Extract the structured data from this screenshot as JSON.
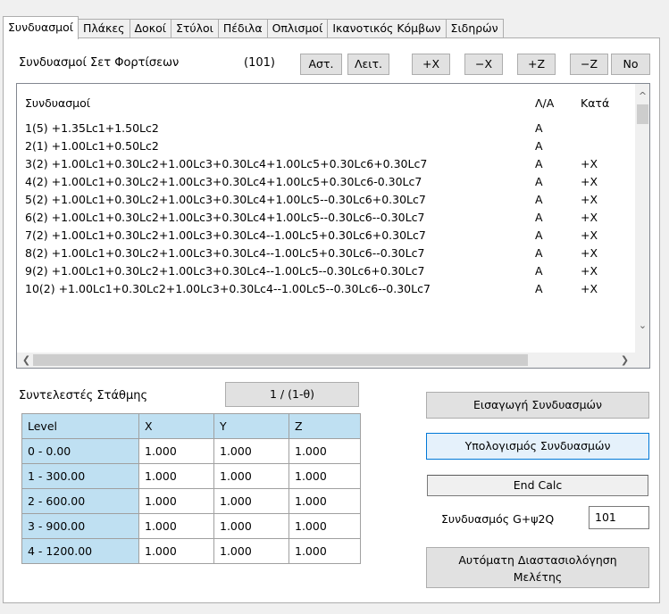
{
  "tabs": [
    "Συνδυασμοί",
    "Πλάκες",
    "Δοκοί",
    "Στύλοι",
    "Πέδιλα",
    "Οπλισμοί",
    "Ικανοτικός Κόμβων",
    "Σιδηρών"
  ],
  "active_tab": 0,
  "sets_label": "Συνδυασμοί Σετ Φορτίσεων",
  "sets_count": "(101)",
  "buttons_top": {
    "ast": "Αστ.",
    "leit": "Λειτ.",
    "px": "+X",
    "mx": "−X",
    "pz": "+Z",
    "mz": "−Z",
    "no": "No"
  },
  "list": {
    "headers": [
      "Συνδυασμοί",
      "Λ/Α",
      "Κατά"
    ],
    "rows": [
      [
        "1(5) +1.35Lc1+1.50Lc2",
        "A",
        ""
      ],
      [
        "2(1) +1.00Lc1+0.50Lc2",
        "A",
        ""
      ],
      [
        "3(2) +1.00Lc1+0.30Lc2+1.00Lc3+0.30Lc4+1.00Lc5+0.30Lc6+0.30Lc7",
        "A",
        "+X"
      ],
      [
        "4(2) +1.00Lc1+0.30Lc2+1.00Lc3+0.30Lc4+1.00Lc5+0.30Lc6-0.30Lc7",
        "A",
        "+X"
      ],
      [
        "5(2) +1.00Lc1+0.30Lc2+1.00Lc3+0.30Lc4+1.00Lc5--0.30Lc6+0.30Lc7",
        "A",
        "+X"
      ],
      [
        "6(2) +1.00Lc1+0.30Lc2+1.00Lc3+0.30Lc4+1.00Lc5--0.30Lc6--0.30Lc7",
        "A",
        "+X"
      ],
      [
        "7(2) +1.00Lc1+0.30Lc2+1.00Lc3+0.30Lc4--1.00Lc5+0.30Lc6+0.30Lc7",
        "A",
        "+X"
      ],
      [
        "8(2) +1.00Lc1+0.30Lc2+1.00Lc3+0.30Lc4--1.00Lc5+0.30Lc6--0.30Lc7",
        "A",
        "+X"
      ],
      [
        "9(2) +1.00Lc1+0.30Lc2+1.00Lc3+0.30Lc4--1.00Lc5--0.30Lc6+0.30Lc7",
        "A",
        "+X"
      ],
      [
        "10(2) +1.00Lc1+0.30Lc2+1.00Lc3+0.30Lc4--1.00Lc5--0.30Lc6--0.30Lc7",
        "A",
        "+X"
      ]
    ]
  },
  "level_label": "Συντελεστές Στάθμης",
  "level_button": "1 / (1-θ)",
  "grid": {
    "headers": [
      "Level",
      "X",
      "Y",
      "Z"
    ],
    "rows": [
      [
        "0 - 0.00",
        "1.000",
        "1.000",
        "1.000"
      ],
      [
        "1 - 300.00",
        "1.000",
        "1.000",
        "1.000"
      ],
      [
        "2 - 600.00",
        "1.000",
        "1.000",
        "1.000"
      ],
      [
        "3 - 900.00",
        "1.000",
        "1.000",
        "1.000"
      ],
      [
        "4 - 1200.00",
        "1.000",
        "1.000",
        "1.000"
      ]
    ]
  },
  "right": {
    "import_btn": "Εισαγωγή Συνδυασμών",
    "calc_btn": "Υπολογισμός Συνδυασμών",
    "status": "End Calc",
    "g_label": "Συνδυασμός G+ψ2Q",
    "g_value": "101",
    "auto_line1": "Αυτόματη Διαστασιολόγηση",
    "auto_line2": "Μελέτης"
  },
  "colors": {
    "grid_header": "#bfe0f2",
    "calc_btn_bg": "#e5f1fb",
    "calc_btn_border": "#0078d7"
  }
}
